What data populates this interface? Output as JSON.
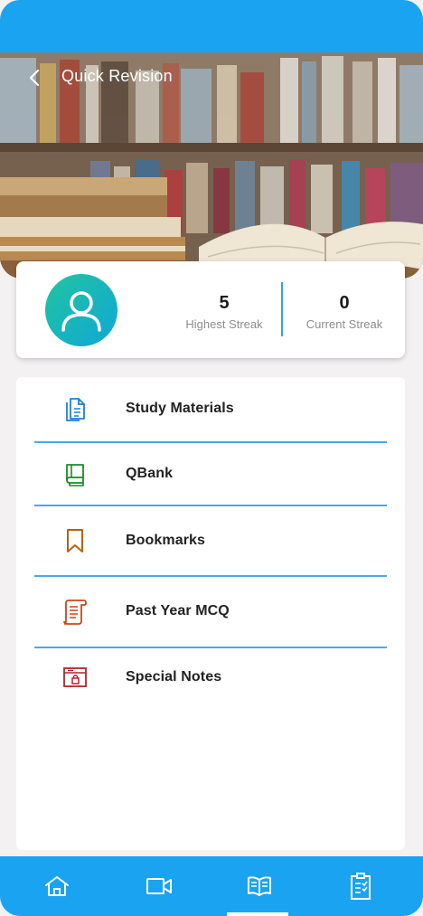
{
  "header": {
    "title": "Quick Revision",
    "back_icon": "chevron-left-icon"
  },
  "profile": {
    "avatar_icon": "user-icon",
    "stats": [
      {
        "value": "5",
        "label": "Highest Streak"
      },
      {
        "value": "0",
        "label": "Current Streak"
      }
    ]
  },
  "menu": {
    "items": [
      {
        "label": "Study Materials",
        "icon": "document-icon",
        "color": "#1f7fd8"
      },
      {
        "label": "QBank",
        "icon": "book-icon",
        "color": "#1b8a2a"
      },
      {
        "label": "Bookmarks",
        "icon": "bookmark-icon",
        "color": "#b8620f"
      },
      {
        "label": "Past Year MCQ",
        "icon": "scroll-icon",
        "color": "#c9471b"
      },
      {
        "label": "Special Notes",
        "icon": "locked-box-icon",
        "color": "#b3242b"
      }
    ]
  },
  "bottom_nav": {
    "items": [
      {
        "icon": "home-icon"
      },
      {
        "icon": "video-icon"
      },
      {
        "icon": "open-book-icon",
        "active": true
      },
      {
        "icon": "clipboard-icon"
      }
    ]
  },
  "colors": {
    "primary": "#1aa3f0",
    "divider": "#4aa8ec"
  }
}
